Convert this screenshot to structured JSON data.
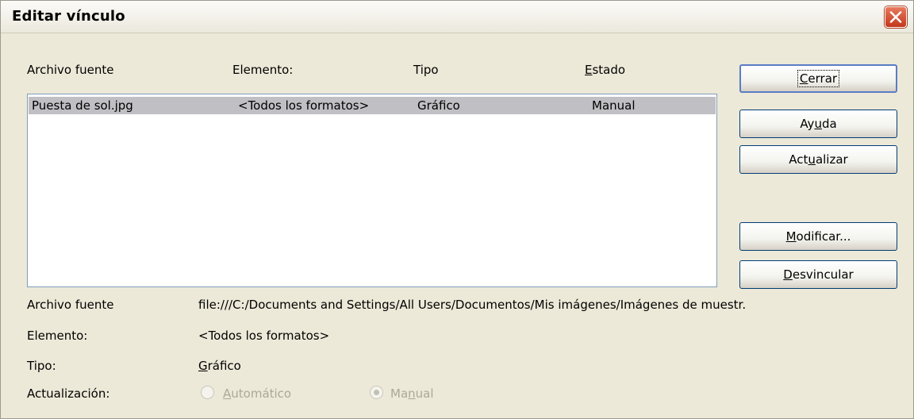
{
  "window": {
    "title": "Editar vínculo"
  },
  "list_headers": [
    "Archivo fuente",
    "Elemento:",
    "Tipo",
    "Estado"
  ],
  "links": [
    {
      "source": "Puesta de sol.jpg",
      "element": "<Todos los formatos>",
      "type": "Gráfico",
      "status": "Manual"
    }
  ],
  "buttons": {
    "close": "Cerrar",
    "help": "Ayuda",
    "update": "Actualizar",
    "modify": "Modificar...",
    "unlink": "Desvincular"
  },
  "details": {
    "source_label": "Archivo fuente",
    "source_value": "file:///C:/Documents and Settings/All Users/Documentos/Mis imágenes/Imágenes de muestr.",
    "element_label": "Elemento:",
    "element_value": "<Todos los formatos>",
    "type_label": "Tipo:",
    "type_value": "Gráfico",
    "update_label": "Actualización:"
  },
  "update_options": [
    {
      "label": "Automático",
      "selected": false,
      "enabled": false
    },
    {
      "label": "Manual",
      "selected": true,
      "enabled": false
    }
  ],
  "icons": {
    "close": "close-icon"
  },
  "colors": {
    "selection": "#bfbfc4",
    "dialog_bg": "#ece9d8",
    "close_red": "#d14a2c"
  }
}
